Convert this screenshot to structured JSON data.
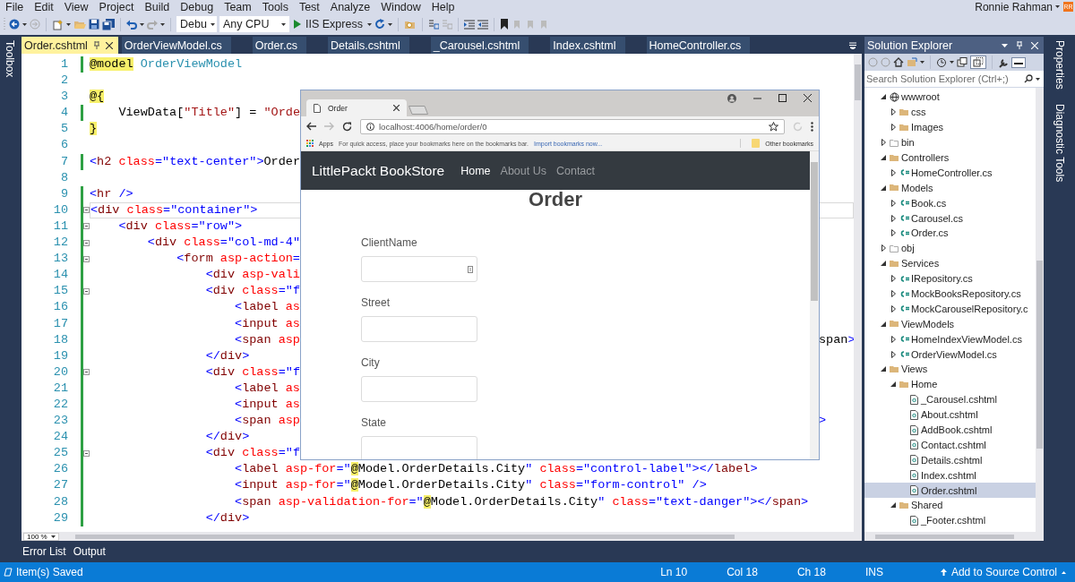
{
  "menu": [
    "File",
    "Edit",
    "View",
    "Project",
    "Build",
    "Debug",
    "Team",
    "Tools",
    "Test",
    "Analyze",
    "Window",
    "Help"
  ],
  "user": {
    "name": "Ronnie Rahman",
    "initials": "RR"
  },
  "toolbar": {
    "configuration": "Debu",
    "platform": "Any CPU",
    "run_target": "IIS Express"
  },
  "left_side_tabs": [
    "Toolbox"
  ],
  "document_tabs": [
    {
      "label": "Order.cshtml",
      "selected": true
    },
    {
      "label": "OrderViewModel.cs",
      "selected": false
    },
    {
      "label": "Order.cs",
      "selected": false
    },
    {
      "label": "Details.cshtml",
      "selected": false
    },
    {
      "label": "_Carousel.cshtml",
      "selected": false
    },
    {
      "label": "Index.cshtml",
      "selected": false
    },
    {
      "label": "HomeController.cs",
      "selected": false
    }
  ],
  "editor": {
    "lines": [
      {
        "number": "1",
        "text": "@model OrderViewModel",
        "changed": true,
        "foldable": false,
        "current": false
      },
      {
        "number": "2",
        "changed": false,
        "foldable": false,
        "current": false
      },
      {
        "number": "3",
        "text": "@{",
        "changed": false,
        "foldable": false,
        "current": false
      },
      {
        "number": "4",
        "text": "    ViewData[\"Title\"] = \"Orde",
        "changed": true,
        "foldable": false,
        "current": false
      },
      {
        "number": "5",
        "text": "}",
        "changed": false,
        "foldable": false,
        "current": false
      },
      {
        "number": "6",
        "changed": false,
        "foldable": false,
        "current": false
      },
      {
        "number": "7",
        "text": "<h2 class=\"text-center\">Order",
        "changed": true,
        "foldable": false,
        "current": false
      },
      {
        "number": "8",
        "changed": false,
        "foldable": false,
        "current": false
      },
      {
        "number": "9",
        "text": "<hr />",
        "changed": true,
        "foldable": false,
        "current": false
      },
      {
        "number": "10",
        "text": "<div class=\"container\">",
        "changed": true,
        "foldable": true,
        "current": true
      },
      {
        "number": "11",
        "text": "    <div class=\"row\">",
        "changed": true,
        "foldable": true,
        "current": false
      },
      {
        "number": "12",
        "text": "        <div class=\"col-md-4\"",
        "changed": true,
        "foldable": true,
        "current": false
      },
      {
        "number": "13",
        "text": "            <form asp-action=",
        "changed": true,
        "foldable": true,
        "current": false
      },
      {
        "number": "14",
        "text": "                <div asp-vali",
        "changed": true,
        "foldable": false,
        "current": false
      },
      {
        "number": "15",
        "text": "                <div class=\"f",
        "changed": true,
        "foldable": true,
        "current": false
      },
      {
        "number": "16",
        "text": "                    <label as",
        "changed": true,
        "foldable": false,
        "current": false
      },
      {
        "number": "17",
        "text": "                    <input as",
        "changed": true,
        "foldable": false,
        "current": false
      },
      {
        "number": "18",
        "text": "                    <span asp",
        "tail": "span>",
        "changed": true,
        "foldable": false,
        "current": false
      },
      {
        "number": "19",
        "text": "                </div>",
        "changed": true,
        "foldable": false,
        "current": false
      },
      {
        "number": "20",
        "text": "                <div class=\"f",
        "changed": true,
        "foldable": true,
        "current": false
      },
      {
        "number": "21",
        "text": "                    <label as",
        "changed": true,
        "foldable": false,
        "current": false
      },
      {
        "number": "22",
        "text": "                    <input as",
        "changed": true,
        "foldable": false,
        "current": false
      },
      {
        "number": "23",
        "text": "                    <span asp",
        "tail": ">",
        "changed": true,
        "foldable": false,
        "current": false
      },
      {
        "number": "24",
        "text": "                </div>",
        "changed": true,
        "foldable": false,
        "current": false
      },
      {
        "number": "25",
        "text": "                <div class=\"f",
        "changed": true,
        "foldable": true,
        "current": false
      },
      {
        "number": "26",
        "text": "                    <label asp-for=\"@Model.OrderDetails.City\" class=\"control-label\"></label>",
        "changed": true,
        "foldable": false,
        "current": false
      },
      {
        "number": "27",
        "text": "                    <input asp-for=\"@Model.OrderDetails.City\" class=\"form-control\" />",
        "changed": true,
        "foldable": false,
        "current": false
      },
      {
        "number": "28",
        "text": "                    <span asp-validation-for=\"@Model.OrderDetails.City\" class=\"text-danger\"></span>",
        "changed": true,
        "foldable": false,
        "current": false
      },
      {
        "number": "29",
        "text": "                </div>",
        "changed": true,
        "foldable": false,
        "current": false
      }
    ],
    "zoom": "100 %"
  },
  "browser": {
    "tab": {
      "title": "Order"
    },
    "address": "localhost:4006/home/order/0",
    "bookmarks_bar": {
      "apps": "Apps",
      "hint": "For quick access, place your bookmarks here on the bookmarks bar.",
      "import_link": "Import bookmarks now...",
      "other": "Other bookmarks"
    },
    "page": {
      "brand": "LittlePackt BookStore",
      "nav": [
        {
          "label": "Home",
          "selected": true
        },
        {
          "label": "About Us",
          "selected": false
        },
        {
          "label": "Contact",
          "selected": false
        }
      ],
      "heading": "Order",
      "fields": [
        {
          "label": "ClientName",
          "autofill_icon": true
        },
        {
          "label": "Street",
          "autofill_icon": false
        },
        {
          "label": "City",
          "autofill_icon": false
        },
        {
          "label": "State",
          "autofill_icon": false
        }
      ]
    }
  },
  "solution_explorer": {
    "title": "Solution Explorer",
    "search": {
      "placeholder": "Search Solution Explorer (Ctrl+;)"
    },
    "tree": [
      {
        "label": "wwwroot",
        "kind": "web",
        "expanded": true,
        "selected": false,
        "children": [
          {
            "label": "css",
            "kind": "folder",
            "expanded": false,
            "selected": false
          },
          {
            "label": "Images",
            "kind": "folder",
            "expanded": false,
            "selected": false
          }
        ]
      },
      {
        "label": "bin",
        "kind": "hidden-folder",
        "expanded": false,
        "selected": false
      },
      {
        "label": "Controllers",
        "kind": "folder",
        "expanded": true,
        "selected": false,
        "children": [
          {
            "label": "HomeController.cs",
            "kind": "cs",
            "expanded": false,
            "selected": false
          }
        ]
      },
      {
        "label": "Models",
        "kind": "folder",
        "expanded": true,
        "selected": false,
        "children": [
          {
            "label": "Book.cs",
            "kind": "cs",
            "expanded": false,
            "selected": false
          },
          {
            "label": "Carousel.cs",
            "kind": "cs",
            "expanded": false,
            "selected": false
          },
          {
            "label": "Order.cs",
            "kind": "cs",
            "expanded": false,
            "selected": false
          }
        ]
      },
      {
        "label": "obj",
        "kind": "hidden-folder",
        "expanded": false,
        "selected": false
      },
      {
        "label": "Services",
        "kind": "folder",
        "expanded": true,
        "selected": false,
        "children": [
          {
            "label": "IRepository.cs",
            "kind": "cs",
            "expanded": false,
            "selected": false
          },
          {
            "label": "MockBooksRepository.cs",
            "kind": "cs",
            "expanded": false,
            "selected": false
          },
          {
            "label": "MockCarouselRepository.c",
            "kind": "cs",
            "expanded": false,
            "selected": false
          }
        ]
      },
      {
        "label": "ViewModels",
        "kind": "folder",
        "expanded": true,
        "selected": false,
        "children": [
          {
            "label": "HomeIndexViewModel.cs",
            "kind": "cs",
            "expanded": false,
            "selected": false
          },
          {
            "label": "OrderViewModel.cs",
            "kind": "cs",
            "expanded": false,
            "selected": false
          }
        ]
      },
      {
        "label": "Views",
        "kind": "folder",
        "expanded": true,
        "selected": false,
        "children": [
          {
            "label": "Home",
            "kind": "folder",
            "expanded": true,
            "selected": false,
            "children": [
              {
                "label": "_Carousel.cshtml",
                "kind": "cshtml",
                "selected": false
              },
              {
                "label": "About.cshtml",
                "kind": "cshtml",
                "selected": false
              },
              {
                "label": "AddBook.cshtml",
                "kind": "cshtml",
                "selected": false
              },
              {
                "label": "Contact.cshtml",
                "kind": "cshtml",
                "selected": false
              },
              {
                "label": "Details.cshtml",
                "kind": "cshtml",
                "selected": false
              },
              {
                "label": "Index.cshtml",
                "kind": "cshtml",
                "selected": false
              },
              {
                "label": "Order.cshtml",
                "kind": "cshtml",
                "selected": true
              }
            ]
          },
          {
            "label": "Shared",
            "kind": "folder",
            "expanded": true,
            "selected": false,
            "children": [
              {
                "label": "_Footer.cshtml",
                "kind": "cshtml",
                "selected": false
              }
            ]
          }
        ]
      }
    ]
  },
  "right_side_tabs": [
    "Properties",
    "Diagnostic Tools"
  ],
  "tool_tabs": [
    "Error List",
    "Output"
  ],
  "status_bar": {
    "message": "Item(s) Saved",
    "line": "Ln 10",
    "column": "Col 18",
    "char": "Ch 18",
    "mode": "INS",
    "source_control": "Add to Source Control"
  }
}
